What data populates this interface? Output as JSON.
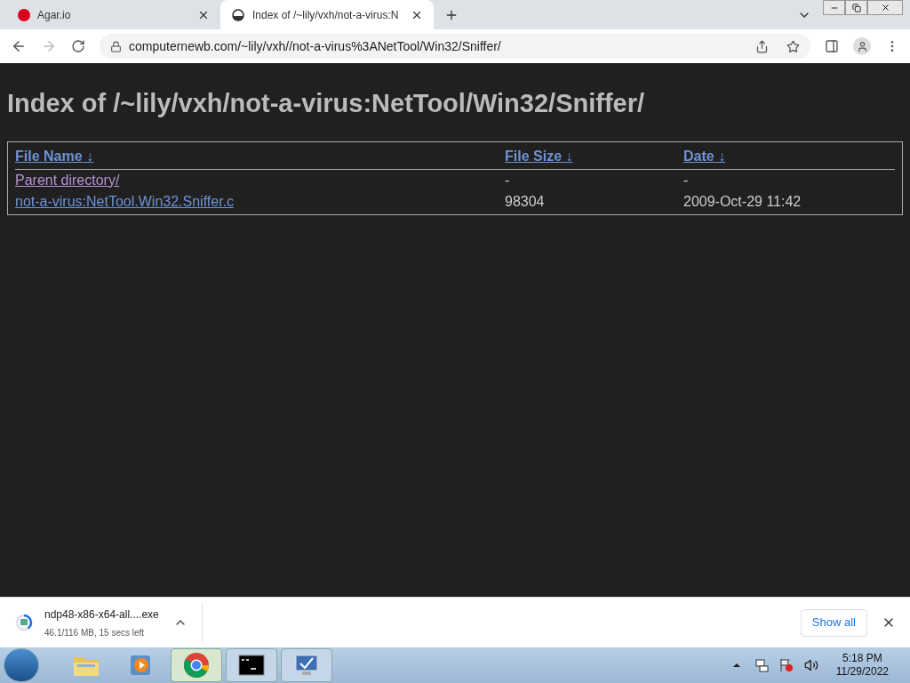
{
  "tabs": [
    {
      "title": "Agar.io",
      "selected": false,
      "kind": "dot",
      "color": "#d9001b"
    },
    {
      "title": "Index of /~lily/vxh/not-a-virus:N",
      "selected": true,
      "kind": "site"
    }
  ],
  "address_bar": {
    "url": "computernewb.com/~lily/vxh//not-a-virus%3ANetTool/Win32/Sniffer/"
  },
  "page": {
    "heading": "Index of /~lily/vxh/not-a-virus:NetTool/Win32/Sniffer/",
    "table": {
      "columns": [
        {
          "label": "File Name",
          "sort": "↓"
        },
        {
          "label": "File Size",
          "sort": "↓"
        },
        {
          "label": "Date",
          "sort": "↓"
        }
      ],
      "rows": [
        {
          "name": "Parent directory/",
          "visited": true,
          "size": "-",
          "date": "-"
        },
        {
          "name": "not-a-virus:NetTool.Win32.Sniffer.c",
          "visited": false,
          "size": "98304",
          "date": "2009-Oct-29 11:42"
        }
      ]
    }
  },
  "download": {
    "filename": "ndp48-x86-x64-all....exe",
    "status": "46.1/116 MB, 15 secs left",
    "level": 0.4,
    "show_all": "Show all"
  },
  "taskbar": {
    "items": [
      {
        "kind": "folder",
        "selected": false
      },
      {
        "kind": "media",
        "selected": false
      },
      {
        "kind": "chrome",
        "selected": true
      },
      {
        "kind": "terminal",
        "selected": false
      },
      {
        "kind": "monitor",
        "selected": false
      }
    ],
    "time": "5:18 PM",
    "date": "11/29/2022"
  }
}
